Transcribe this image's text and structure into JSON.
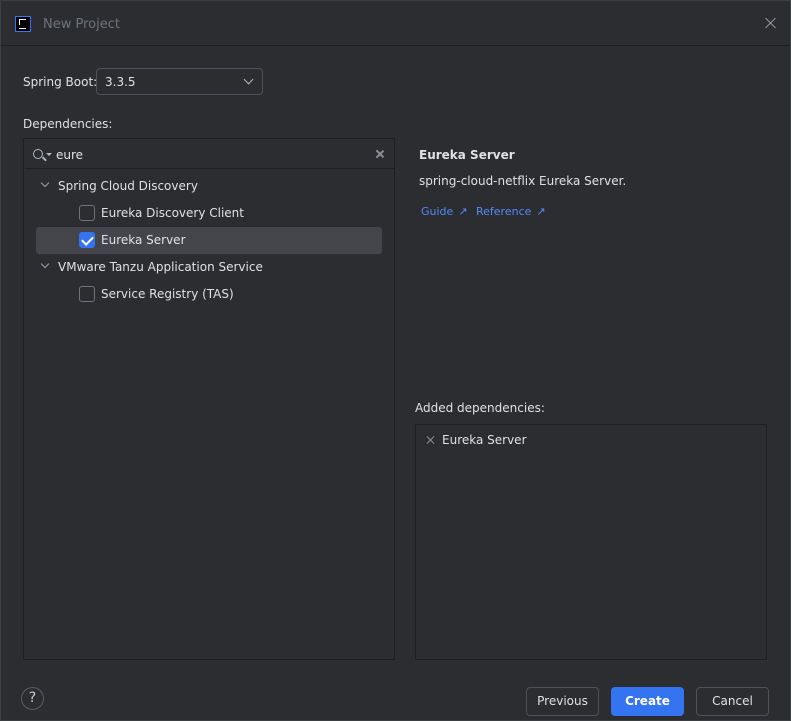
{
  "window": {
    "title": "New Project",
    "app_icon": "intellij-icon"
  },
  "spring_boot": {
    "label": "Spring Boot:",
    "value": "3.3.5"
  },
  "dependencies": {
    "label": "Dependencies:",
    "search": {
      "value": "eure"
    },
    "groups": [
      {
        "label": "Spring Cloud Discovery",
        "expanded": true,
        "items": [
          {
            "label": "Eureka Discovery Client",
            "checked": false
          },
          {
            "label": "Eureka Server",
            "checked": true,
            "selected": true
          }
        ]
      },
      {
        "label": "VMware Tanzu Application Service",
        "expanded": true,
        "items": [
          {
            "label": "Service Registry (TAS)",
            "checked": false
          }
        ]
      }
    ]
  },
  "detail": {
    "title": "Eureka Server",
    "description": "spring-cloud-netflix Eureka Server.",
    "links": [
      {
        "label": "Guide",
        "icon": "external-link-icon"
      },
      {
        "label": "Reference",
        "icon": "external-link-icon"
      }
    ]
  },
  "added": {
    "label": "Added dependencies:",
    "items": [
      {
        "label": "Eureka Server"
      }
    ]
  },
  "footer": {
    "help": "?",
    "previous": "Previous",
    "create": "Create",
    "cancel": "Cancel"
  },
  "colors": {
    "accent": "#3574f0",
    "link": "#548af7",
    "background": "#2b2d30"
  }
}
